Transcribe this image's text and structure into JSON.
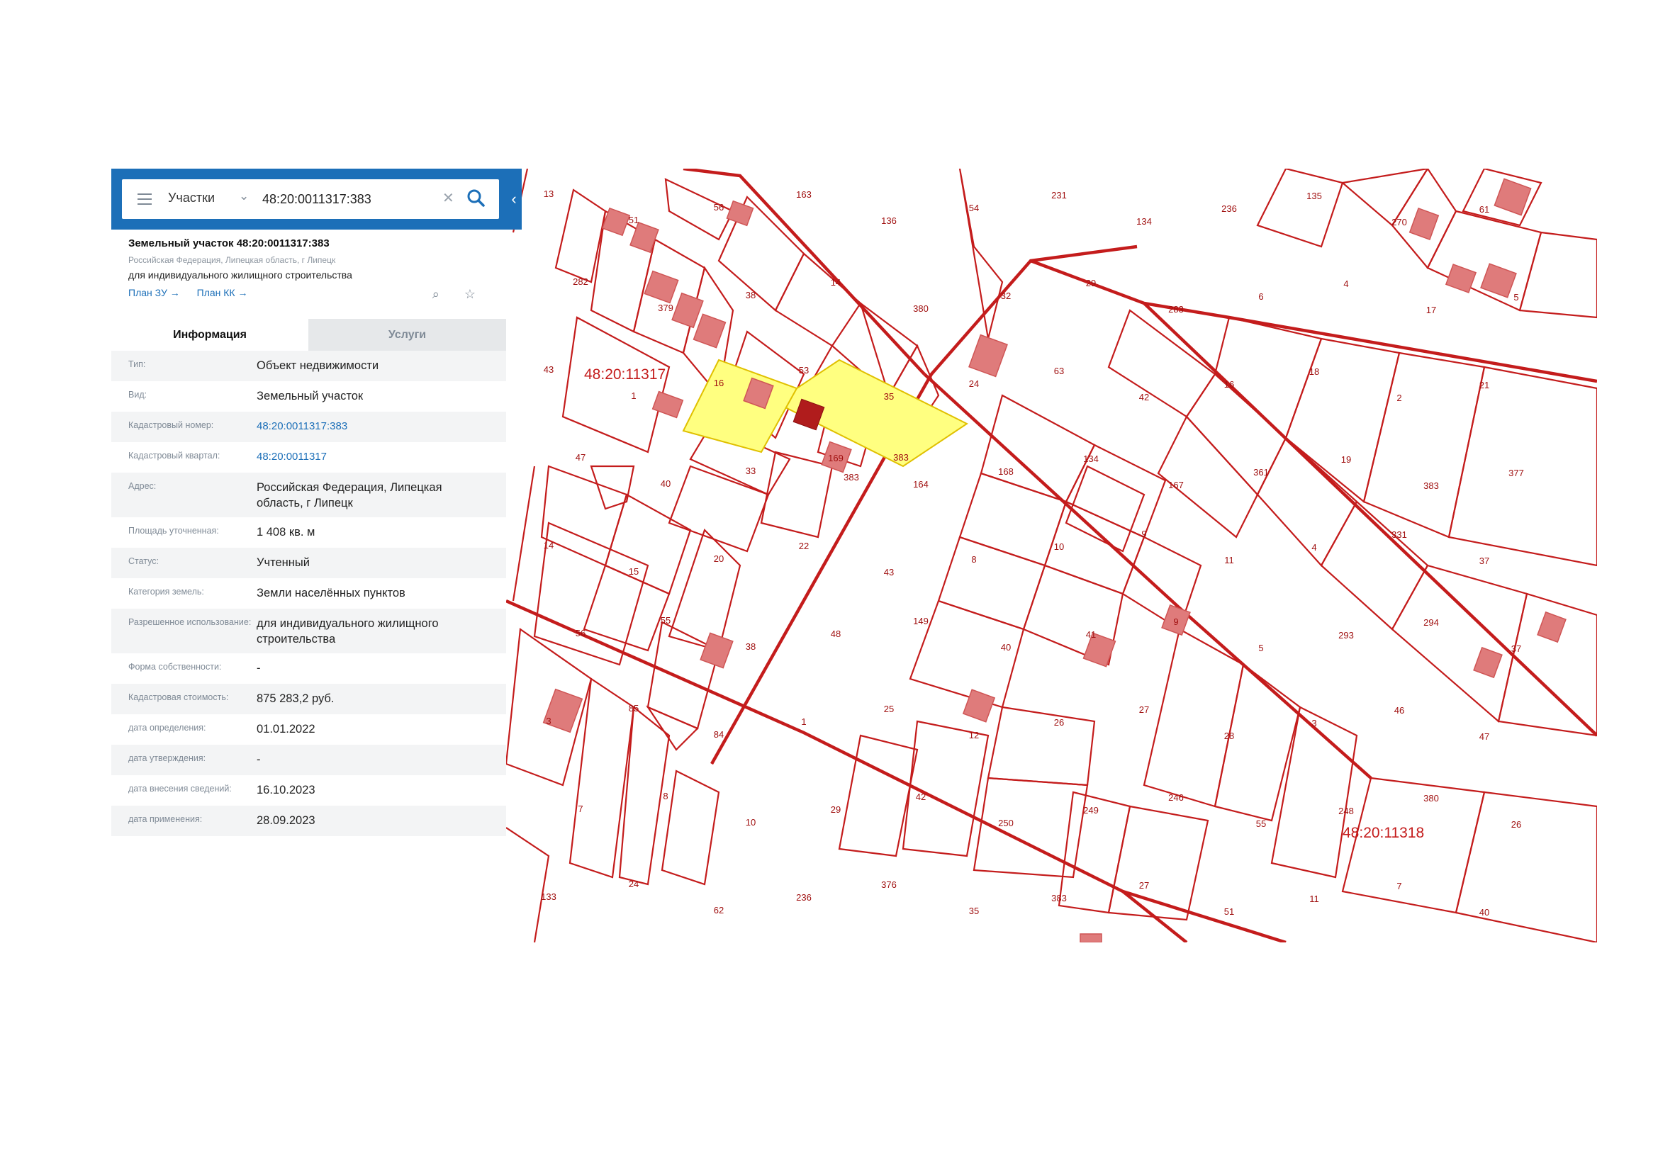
{
  "search": {
    "scope": "Участки",
    "query": "48:20:0011317:383"
  },
  "object": {
    "title": "Земельный участок 48:20:0011317:383",
    "address_small": "Российская Федерация, Липецкая область, г Липецк",
    "purpose": "для индивидуального жилищного строительства",
    "link_plan_zu": "План ЗУ →",
    "link_plan_kk": "План КК →"
  },
  "tabs": [
    "Информация",
    "Услуги"
  ],
  "info_rows": [
    {
      "label": "Тип:",
      "value": "Объект недвижимости"
    },
    {
      "label": "Вид:",
      "value": "Земельный участок"
    },
    {
      "label": "Кадастровый номер:",
      "value": "48:20:0011317:383",
      "link": true
    },
    {
      "label": "Кадастровый квартал:",
      "value": "48:20:0011317",
      "link": true
    },
    {
      "label": "Адрес:",
      "value": "Российская Федерация, Липецкая область, г Липецк"
    },
    {
      "label": "Площадь уточненная:",
      "value": "1 408 кв. м"
    },
    {
      "label": "Статус:",
      "value": "Учтенный"
    },
    {
      "label": "Категория земель:",
      "value": "Земли населённых пунктов"
    },
    {
      "label": "Разрешенное использование:",
      "value": "для индивидуального жилищного строительства"
    },
    {
      "label": "Форма собственности:",
      "value": "-"
    },
    {
      "label": "Кадастровая стоимость:",
      "value": "875 283,2 руб."
    },
    {
      "label": "дата определения:",
      "value": "01.01.2022"
    },
    {
      "label": "дата утверждения:",
      "value": "-"
    },
    {
      "label": "дата внесения сведений:",
      "value": "16.10.2023"
    },
    {
      "label": "дата применения:",
      "value": "28.09.2023"
    }
  ],
  "map": {
    "quarter_labels": [
      "48:20:11317",
      "48:20:11318"
    ],
    "selected_parcel": "383",
    "highlight_color": "#ffff80",
    "line_color": "#c41c1c",
    "parcel_labels": [
      "13",
      "51",
      "56",
      "163",
      "136",
      "54",
      "231",
      "134",
      "236",
      "135",
      "270",
      "61",
      "282",
      "379",
      "38",
      "14",
      "380",
      "32",
      "29",
      "283",
      "6",
      "4",
      "17",
      "5",
      "43",
      "1",
      "16",
      "53",
      "35",
      "24",
      "63",
      "42",
      "16",
      "18",
      "2",
      "21",
      "47",
      "40",
      "33",
      "169",
      "164",
      "168",
      "134",
      "167",
      "361",
      "19",
      "383",
      "377",
      "14",
      "15",
      "20",
      "22",
      "43",
      "8",
      "10",
      "9",
      "11",
      "4",
      "331",
      "37",
      "56",
      "55",
      "38",
      "48",
      "149",
      "40",
      "41",
      "9",
      "5",
      "293",
      "294",
      "37",
      "3",
      "85",
      "84",
      "1",
      "25",
      "12",
      "26",
      "27",
      "28",
      "3",
      "46",
      "47",
      "7",
      "8",
      "10",
      "29",
      "42",
      "250",
      "249",
      "246",
      "55",
      "248",
      "380",
      "26",
      "133",
      "24",
      "62",
      "236",
      "376",
      "35",
      "383",
      "27",
      "51",
      "11",
      "7",
      "40"
    ]
  }
}
